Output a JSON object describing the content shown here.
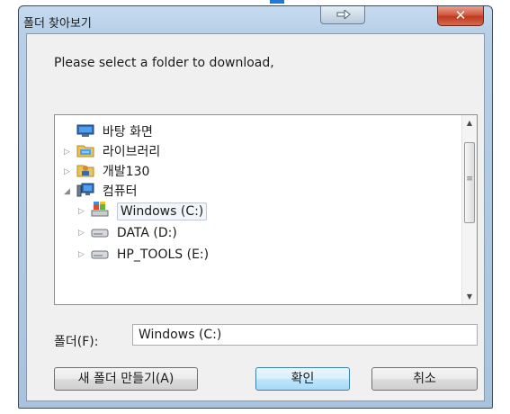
{
  "window": {
    "title": "폴더 찾아보기"
  },
  "prompt": "Please select a folder to download,",
  "tree": {
    "items": [
      {
        "label": "바탕 화면",
        "icon": "desktop-icon",
        "expander": "",
        "level": 0
      },
      {
        "label": "라이브러리",
        "icon": "library-icon",
        "expander": "▷",
        "level": 1
      },
      {
        "label": "개발130",
        "icon": "user-folder-icon",
        "expander": "▷",
        "level": 1
      },
      {
        "label": "컴퓨터",
        "icon": "computer-icon",
        "expander": "◢",
        "level": 1
      },
      {
        "label": "Windows (C:)",
        "icon": "system-drive-icon",
        "expander": "▷",
        "level": 2,
        "selected": true
      },
      {
        "label": "DATA (D:)",
        "icon": "drive-icon",
        "expander": "▷",
        "level": 2
      },
      {
        "label": "HP_TOOLS (E:)",
        "icon": "drive-icon",
        "expander": "▷",
        "level": 2
      }
    ]
  },
  "folder_field": {
    "label": "폴더(F):",
    "value": "Windows (C:)"
  },
  "buttons": {
    "new_folder": "새 폴더 만들기(A)",
    "ok": "확인",
    "cancel": "취소"
  },
  "icons": {
    "close": "close-icon",
    "help": "help-arrow-icon",
    "scroll_up": "scroll-up-icon",
    "scroll_down": "scroll-down-icon"
  },
  "colors": {
    "title_gradient_top": "#c6dbf0",
    "close_button": "#d25b40",
    "default_button_border": "#3c7fb1"
  }
}
